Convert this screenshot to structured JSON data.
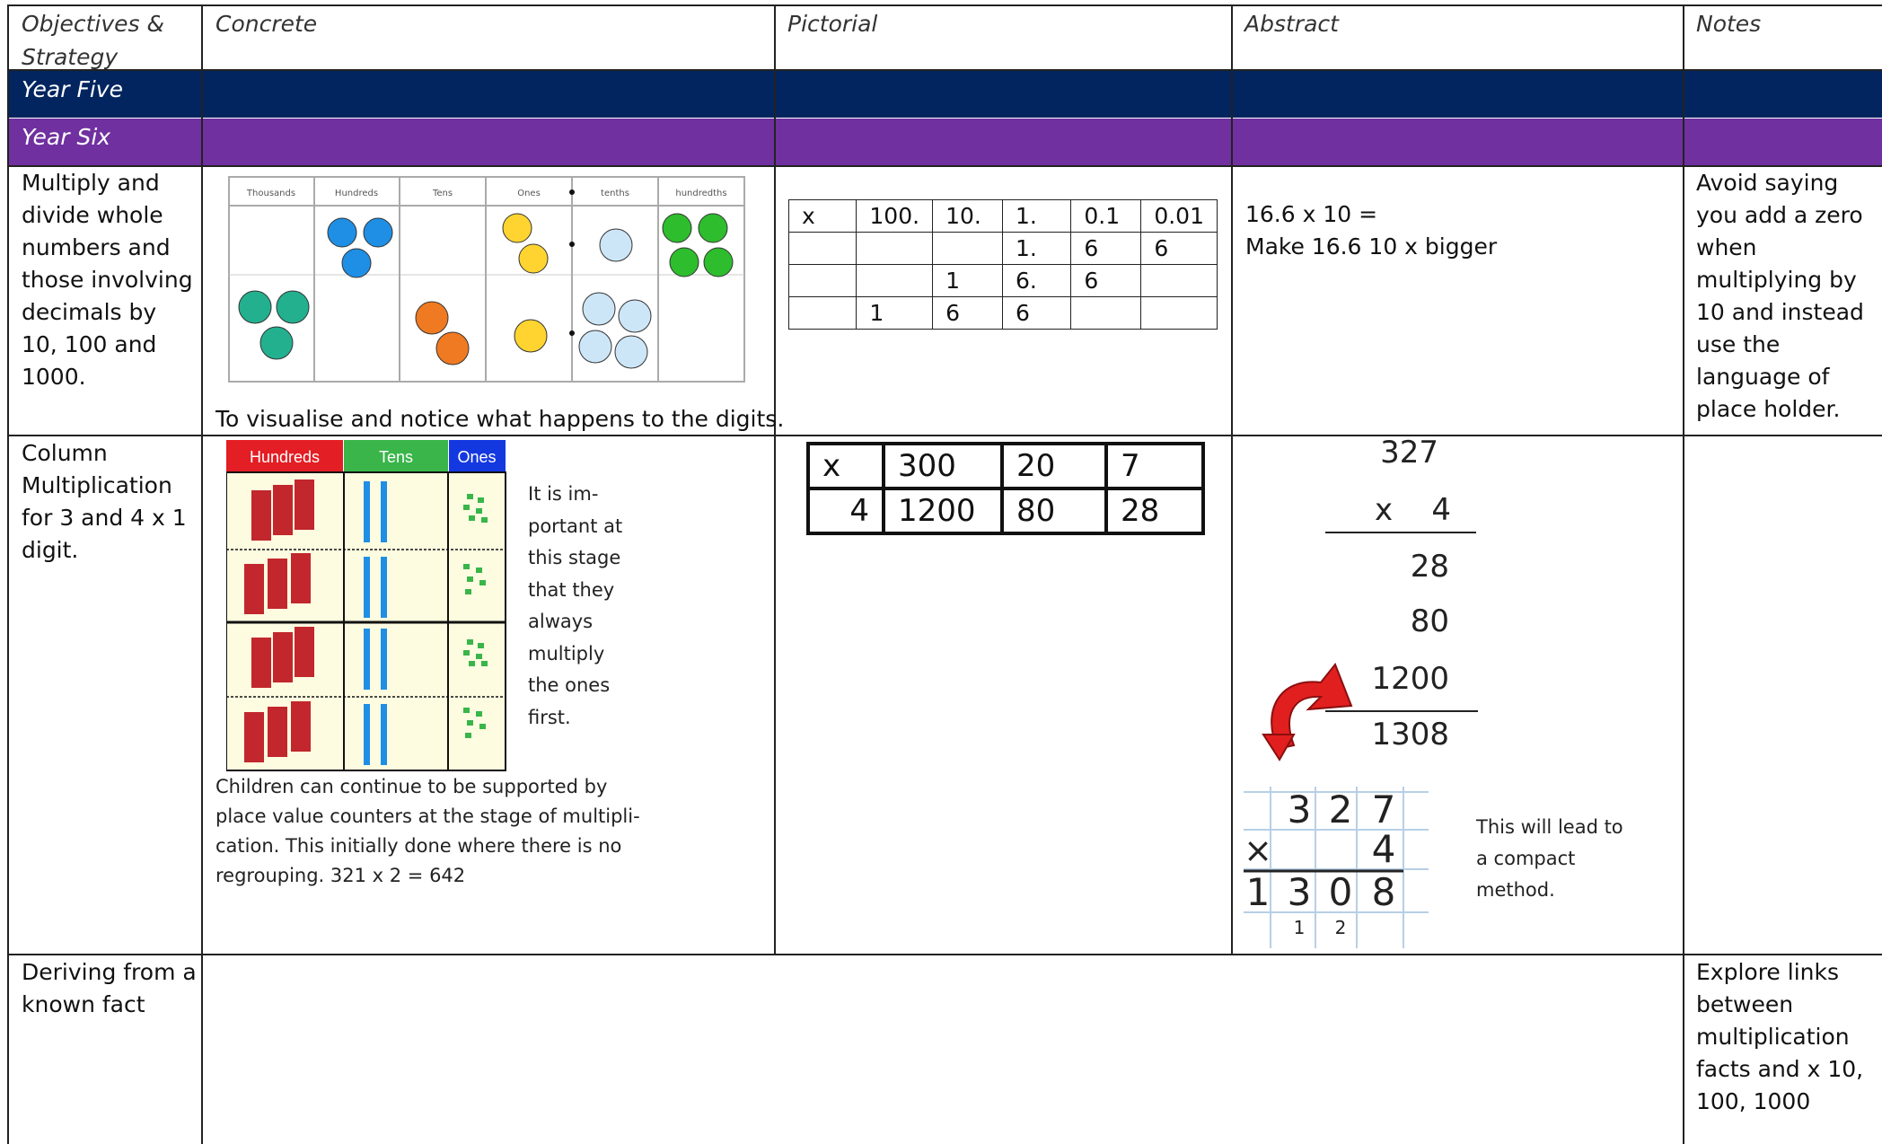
{
  "header": {
    "col1": "Objectives & Strategy",
    "col2": "Concrete",
    "col3": "Pictorial",
    "col4": "Abstract",
    "col5": "Notes"
  },
  "bands": {
    "year5": "Year Five",
    "year6": "Year Six",
    "year5_color": "#022560",
    "year6_color": "#7030a0"
  },
  "row1": {
    "objective": "Multiply and divide whole numbers and those involving decimals by 10, 100 and 1000.",
    "concrete_caption": "To visualise and notice what happens to the digits.",
    "pv_chart_headers": [
      "Thousands",
      "Hundreds",
      "Tens",
      "Ones",
      "tenths",
      "hundredths"
    ],
    "pictorial_table": [
      [
        "x",
        "100.",
        "10.",
        "1.",
        "0.1",
        "0.01"
      ],
      [
        "",
        "",
        "",
        "1.",
        "6",
        "6"
      ],
      [
        "",
        "",
        "1",
        "6.",
        "6",
        ""
      ],
      [
        "",
        "1",
        "6",
        "6",
        "",
        ""
      ]
    ],
    "abstract_line1": "16.6 x 10 =",
    "abstract_line2": "Make 16.6 10 x bigger",
    "notes": "Avoid saying you add a zero when multiplying by 10 and instead use the language of place holder."
  },
  "row2": {
    "objective": "Column Multiplication for 3 and 4 x 1 digit.",
    "grid_headers": [
      "Hundreds",
      "Tens",
      "Ones"
    ],
    "grid_header_colors": [
      "#e31e24",
      "#39b54a",
      "#1438e0"
    ],
    "side_note": [
      "It is im-",
      "portant at",
      "this stage",
      "that they",
      "always",
      "multiply",
      "the ones",
      "first."
    ],
    "caption_lines": [
      "Children can continue to be supported by",
      "place value counters at the stage of multipli-",
      "cation. This initially done where there is no",
      "regrouping.   321 x 2 = 642"
    ],
    "pictorial_grid": [
      [
        "x",
        "300",
        "20",
        "7"
      ],
      [
        "4",
        "1200",
        "80",
        "28"
      ]
    ],
    "abstract": {
      "top": "327",
      "mult": "x    4",
      "p1": "28",
      "p2": "80",
      "p3": "1200",
      "total": "1308"
    },
    "compact": {
      "row1": [
        "",
        "3",
        "2",
        "7"
      ],
      "row2": [
        "×",
        "",
        "",
        "4"
      ],
      "row3": [
        "1",
        "3",
        "0",
        "8"
      ],
      "carry": [
        "",
        "1",
        "2",
        ""
      ]
    },
    "compact_note": [
      "This will lead to",
      "a compact",
      "method."
    ]
  },
  "row3": {
    "objective": "Deriving from a known fact",
    "notes": "Explore links between multiplication facts and x 10, 100, 1000"
  }
}
